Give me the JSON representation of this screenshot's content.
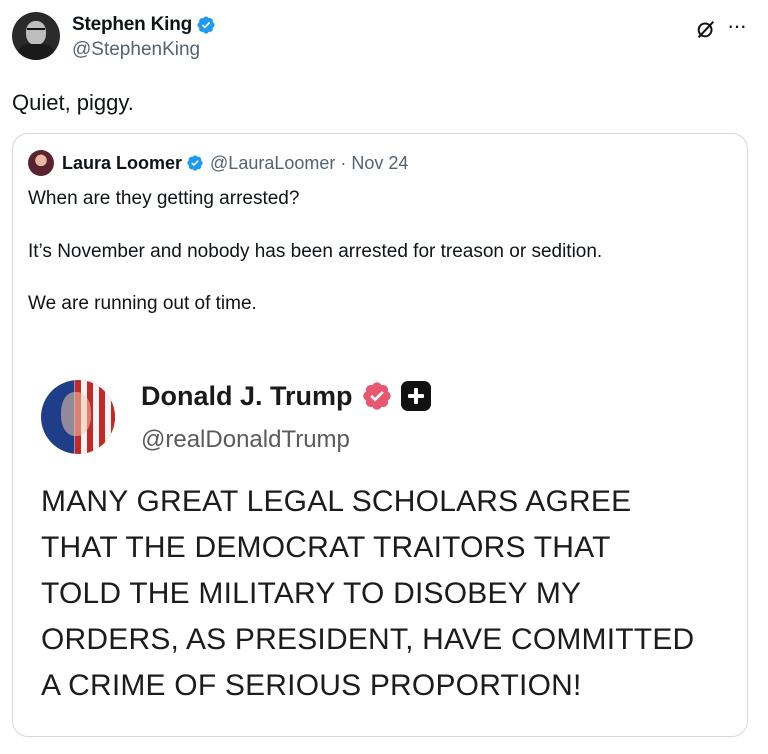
{
  "post": {
    "author_name": "Stephen King",
    "author_handle": "@StephenKing",
    "text": "Quiet, piggy.",
    "icons": {
      "verified": "verified-badge-icon",
      "grok": "grok-icon",
      "more": "more-icon"
    },
    "more_label": "···"
  },
  "quote": {
    "author_name": "Laura Loomer",
    "author_handle": "@LauraLoomer",
    "separator": "·",
    "date": "Nov 24",
    "lines": [
      "When are they getting arrested?",
      "It’s November and nobody has been arrested for treason or sedition.",
      "We are running out of time."
    ]
  },
  "embedded_post": {
    "author_name": "Donald J. Trump",
    "author_handle": "@realDonaldTrump",
    "lines": [
      "MANY GREAT LEGAL SCHOLARS AGREE",
      "THAT THE DEMOCRAT TRAITORS THAT",
      "TOLD THE MILITARY TO DISOBEY MY",
      "ORDERS, AS PRESIDENT, HAVE COMMITTED",
      "A CRIME OF SERIOUS PROPORTION!"
    ]
  },
  "colors": {
    "verified_blue": "#1d9bf0",
    "truth_badge_pink": "#e8566f",
    "secondary_text": "#536471",
    "border": "#cfd9de"
  }
}
